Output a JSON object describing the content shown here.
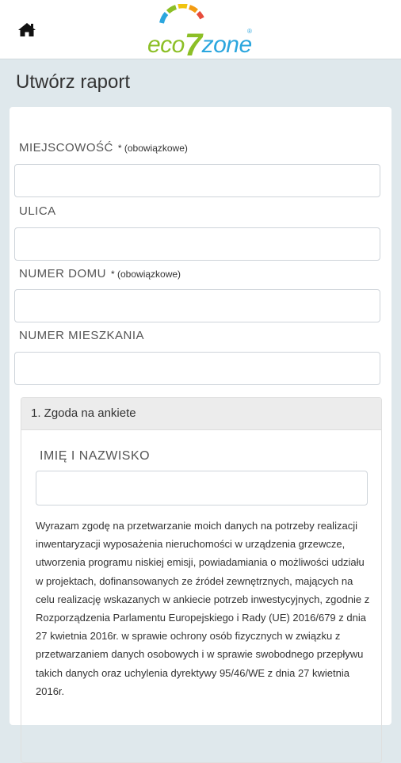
{
  "header": {
    "home_icon": "home-icon",
    "logo": {
      "part1": "eco",
      "part2": "7",
      "part3": "zone",
      "reg": "®"
    },
    "logo_colors": [
      "#8cbf26",
      "#2ba6de",
      "#f39c12",
      "#e74c3c"
    ]
  },
  "page": {
    "title": "Utwórz raport"
  },
  "form": {
    "fields": [
      {
        "label": "MIEJSCOWOŚĆ",
        "required": "* (obowiązkowe)",
        "value": ""
      },
      {
        "label": "ULICA",
        "value": ""
      },
      {
        "label": "NUMER DOMU",
        "required": "* (obowiązkowe)",
        "value": ""
      },
      {
        "label": "NUMER MIESZKANIA",
        "value": ""
      }
    ]
  },
  "consent": {
    "title": "1. Zgoda na ankiete",
    "name_label": "IMIĘ I NAZWISKO",
    "name_value": "",
    "text": "Wyrazam zgodę na przetwarzanie moich danych na potrzeby realizacji inwentaryzacji wyposażenia nieruchomości w urządzenia grzewcze, utworzenia programu niskiej emisji, powiadamiania o możliwości udziału w projektach, dofinansowanych ze źródeł zewnętrznych, mających na celu realizację wskazanych w ankiecie potrzeb inwestycyjnych, zgodnie z Rozporządzenia Parlamentu Europejskiego i Rady (UE) 2016/679 z dnia 27 kwietnia 2016r. w sprawie ochrony osób fizycznych w związku z przetwarzaniem danych osobowych i w sprawie swobodnego przepływu takich danych oraz uchylenia dyrektywy 95/46/WE z dnia 27 kwietnia 2016r."
  }
}
